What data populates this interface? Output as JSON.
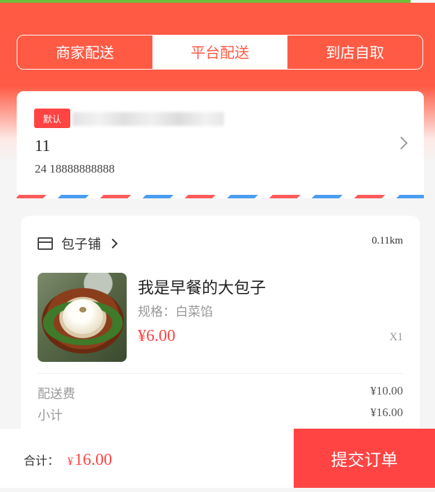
{
  "tabs": [
    {
      "label": "商家配送",
      "active": false
    },
    {
      "label": "平台配送",
      "active": true
    },
    {
      "label": "到店自取",
      "active": false
    }
  ],
  "address": {
    "badge": "默认",
    "name": "11",
    "phone": "24 18888888888"
  },
  "order": {
    "shop_name": "包子铺",
    "distance": "0.11km",
    "item": {
      "name": "我是早餐的大包子",
      "spec": "规格：白菜馅",
      "price": "¥6.00",
      "qty": "X1"
    },
    "fees": [
      {
        "label": "配送费",
        "value": "¥10.00"
      },
      {
        "label": "小计",
        "value": "¥16.00"
      }
    ]
  },
  "footer": {
    "total_label": "合计：",
    "currency": "¥",
    "total_amount": "16.00",
    "submit_label": "提交订单"
  },
  "colors": {
    "brand": "#ff5a44",
    "price": "#ff4443",
    "stripe_blue": "#4a9df0",
    "stripe_red": "#ff5a5a"
  }
}
